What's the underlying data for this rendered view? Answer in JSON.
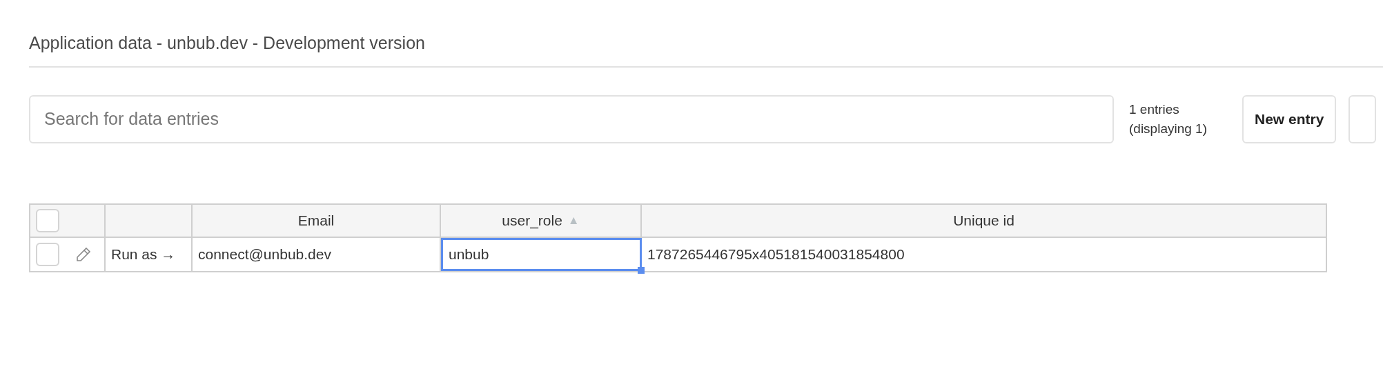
{
  "page_title": "Application data - unbub.dev - Development version",
  "search": {
    "placeholder": "Search for data entries"
  },
  "entry_count": {
    "line_1": "1 entries",
    "line_2": "(displaying 1)"
  },
  "buttons": [
    "New entry"
  ],
  "table": {
    "header_checkbox": {
      "checked": false
    },
    "columns": [
      {
        "label": "Email"
      },
      {
        "label": "user_role",
        "sort_indicator": "▲"
      },
      {
        "label": "Unique id"
      }
    ],
    "rows": [
      {
        "checked": false,
        "action": "Run as →",
        "cells": [
          {
            "text": "connect@unbub.dev",
            "selected": false
          },
          {
            "text": "unbub",
            "selected": true
          },
          {
            "text": "1787265446795x405181540031854800",
            "selected": false
          }
        ]
      }
    ]
  }
}
